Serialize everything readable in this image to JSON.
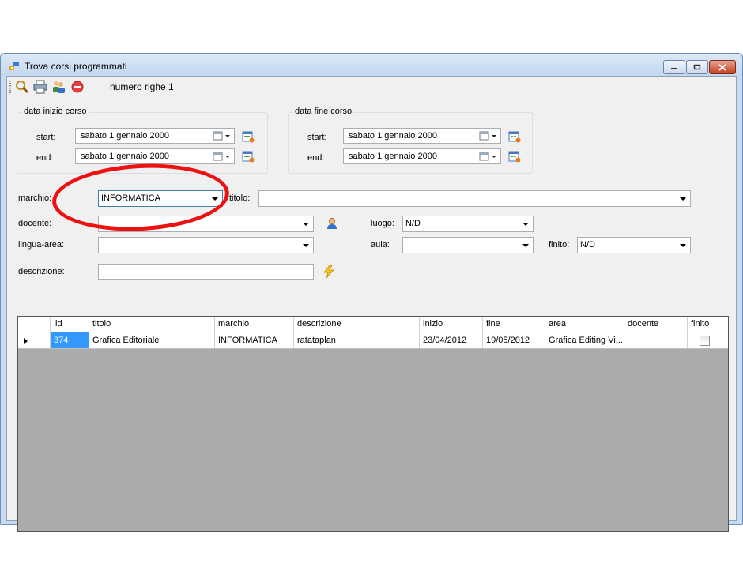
{
  "window": {
    "title": "Trova corsi programmati",
    "controls": [
      "minimize",
      "maximize",
      "close"
    ]
  },
  "toolbar": {
    "icons": [
      "search-icon",
      "print-icon",
      "users-icon",
      "stop-icon"
    ],
    "rows_label": "numero righe 1"
  },
  "date_start_group": {
    "legend": "data inizio corso",
    "start_label": "start:",
    "end_label": "end:",
    "start_value": "sabato    1  gennaio  2000",
    "end_value": "sabato    1  gennaio  2000"
  },
  "date_end_group": {
    "legend": "data fine corso",
    "start_label": "start:",
    "end_label": "end:",
    "start_value": "sabato    1  gennaio  2000",
    "end_value": "sabato    1  gennaio  2000"
  },
  "filters": {
    "marchio_label": "marchio:",
    "marchio_value": "INFORMATICA",
    "titolo_label": "titolo:",
    "titolo_value": "",
    "docente_label": "docente:",
    "docente_value": "",
    "luogo_label": "luogo:",
    "luogo_value": "N/D",
    "lingua_label": "lingua-area:",
    "lingua_value": "",
    "aula_label": "aula:",
    "aula_value": "",
    "finito_label": "finito:",
    "finito_value": "N/D",
    "descrizione_label": "descrizione:",
    "descrizione_value": ""
  },
  "grid": {
    "columns": [
      "id",
      "titolo",
      "marchio",
      "descrizione",
      "inizio",
      "fine",
      "area",
      "docente",
      "finito"
    ],
    "rows": [
      {
        "id": "374",
        "titolo": "Grafica Editoriale",
        "marchio": "INFORMATICA",
        "descrizione": "ratataplan",
        "inizio": "23/04/2012",
        "fine": "19/05/2012",
        "area": "Grafica Editing Vi...",
        "docente": "",
        "finito": false
      }
    ]
  },
  "colors": {
    "annotation_ellipse": "#ee1111",
    "selection": "#3399ff",
    "grid_background": "#ababab"
  }
}
